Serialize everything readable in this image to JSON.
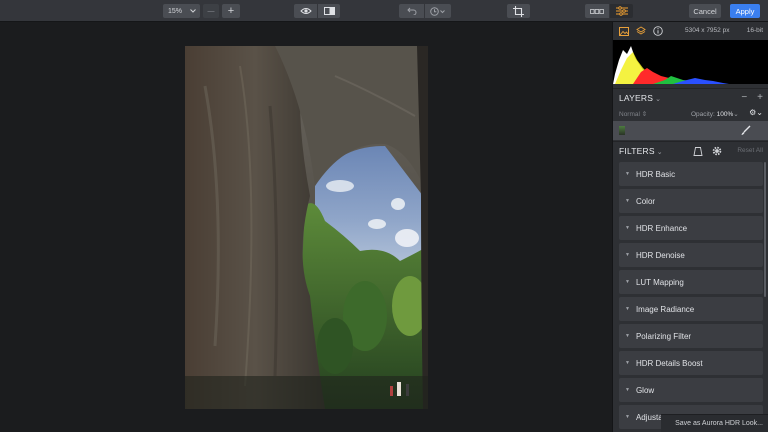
{
  "toolbar": {
    "zoom_value": "15%",
    "zoom_minus": "—",
    "zoom_plus": "+",
    "cancel_label": "Cancel",
    "apply_label": "Apply",
    "colors": {
      "bar": "#34363b",
      "button": "#4a4d53",
      "apply": "#3a7ff0"
    }
  },
  "image_info": {
    "dimensions": "5304 x 7952 px",
    "bit_depth": "16-bit"
  },
  "layers": {
    "title": "LAYERS",
    "chevron": "⌄",
    "minus": "−",
    "plus": "+",
    "blend_mode": "Normal ⇕",
    "opacity_label": "Opacity:",
    "opacity_value": "100%",
    "opacity_chevron": "⌄",
    "gear": "⚙⌄"
  },
  "filters": {
    "title": "FILTERS",
    "chevron": "⌄",
    "reset_label": "Reset All",
    "items": [
      {
        "label": "HDR Basic"
      },
      {
        "label": "Color"
      },
      {
        "label": "HDR Enhance"
      },
      {
        "label": "HDR Denoise"
      },
      {
        "label": "LUT Mapping"
      },
      {
        "label": "Image Radiance"
      },
      {
        "label": "Polarizing Filter"
      },
      {
        "label": "HDR Details Boost"
      },
      {
        "label": "Glow"
      },
      {
        "label": "Adjustable Gradient"
      }
    ]
  },
  "save_look_label": "Save as Aurora HDR Look...",
  "icons": {
    "image": "image-icon",
    "layers": "layers-stack-icon",
    "info": "info-icon",
    "eye": "eye-icon",
    "compare": "compare-icon",
    "undo": "undo-icon",
    "history": "history-icon",
    "crop": "crop-icon",
    "presets": "presets-icon",
    "adjust": "sliders-icon",
    "brush": "brush-icon",
    "mask": "mask-icon",
    "settings": "gear-icon"
  }
}
